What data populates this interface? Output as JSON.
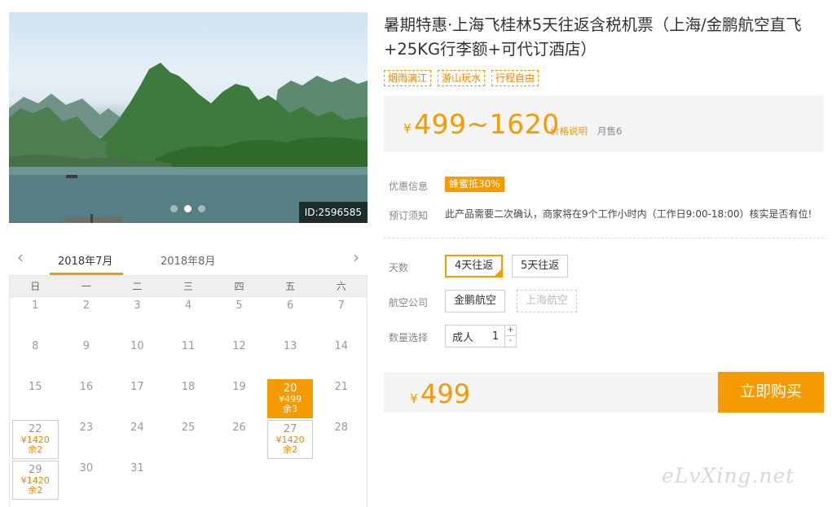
{
  "gallery": {
    "photo_id": "ID:2596585",
    "dots": 3,
    "active_dot": 1
  },
  "calendar": {
    "prev_icon": "chevron-left-icon",
    "next_icon": "chevron-right-icon",
    "months": [
      "2018年7月",
      "2018年8月"
    ],
    "active_month": 0,
    "weekdays": [
      "日",
      "一",
      "二",
      "三",
      "四",
      "五",
      "六"
    ],
    "days": [
      {
        "d": "1"
      },
      {
        "d": "2"
      },
      {
        "d": "3"
      },
      {
        "d": "4"
      },
      {
        "d": "5"
      },
      {
        "d": "6"
      },
      {
        "d": "7"
      },
      {
        "d": "8"
      },
      {
        "d": "9"
      },
      {
        "d": "10"
      },
      {
        "d": "11"
      },
      {
        "d": "12"
      },
      {
        "d": "13"
      },
      {
        "d": "14"
      },
      {
        "d": "15"
      },
      {
        "d": "16"
      },
      {
        "d": "17"
      },
      {
        "d": "18"
      },
      {
        "d": "19"
      },
      {
        "d": "20",
        "price": "¥499",
        "remain": "余3",
        "selected": true
      },
      {
        "d": "21"
      },
      {
        "d": "22",
        "price": "¥1420",
        "remain": "余2"
      },
      {
        "d": "23"
      },
      {
        "d": "24"
      },
      {
        "d": "25"
      },
      {
        "d": "26"
      },
      {
        "d": "27",
        "price": "¥1420",
        "remain": "余2"
      },
      {
        "d": "28"
      },
      {
        "d": "29",
        "price": "¥1420",
        "remain": "余2"
      },
      {
        "d": "30"
      },
      {
        "d": "31"
      }
    ]
  },
  "product": {
    "title": "暑期特惠·上海飞桂林5天往返含税机票（上海/金鹏航空直飞+25KG行李额+可代订酒店）",
    "tags": [
      "烟雨漓江",
      "游山玩水",
      "行程自由"
    ]
  },
  "price_box": {
    "currency": "¥",
    "range": "499~1620",
    "explain": "价格说明",
    "sold": "月售6"
  },
  "info": {
    "promo_label": "优惠信息",
    "promo_badge": "蜂蜜抵30%",
    "notice_label": "预订须知",
    "notice_text": "此产品需要二次确认，商家将在9个工作小时内（工作日9:00-18:00）核实是否有位!"
  },
  "options": {
    "days_label": "天数",
    "days": [
      "4天往返",
      "5天往返"
    ],
    "days_selected": 0,
    "airline_label": "航空公司",
    "airlines": [
      "金鹏航空",
      "上海航空"
    ],
    "quantity_label": "数量选择",
    "quantity_type": "成人",
    "quantity": "1",
    "plus": "+",
    "minus": "-"
  },
  "buy": {
    "currency": "¥",
    "price": "499",
    "button": "立即购买"
  },
  "watermark": "eLvXing.net",
  "colors": {
    "accent": "#f59a00",
    "panel_bg": "#f4f4f4"
  }
}
